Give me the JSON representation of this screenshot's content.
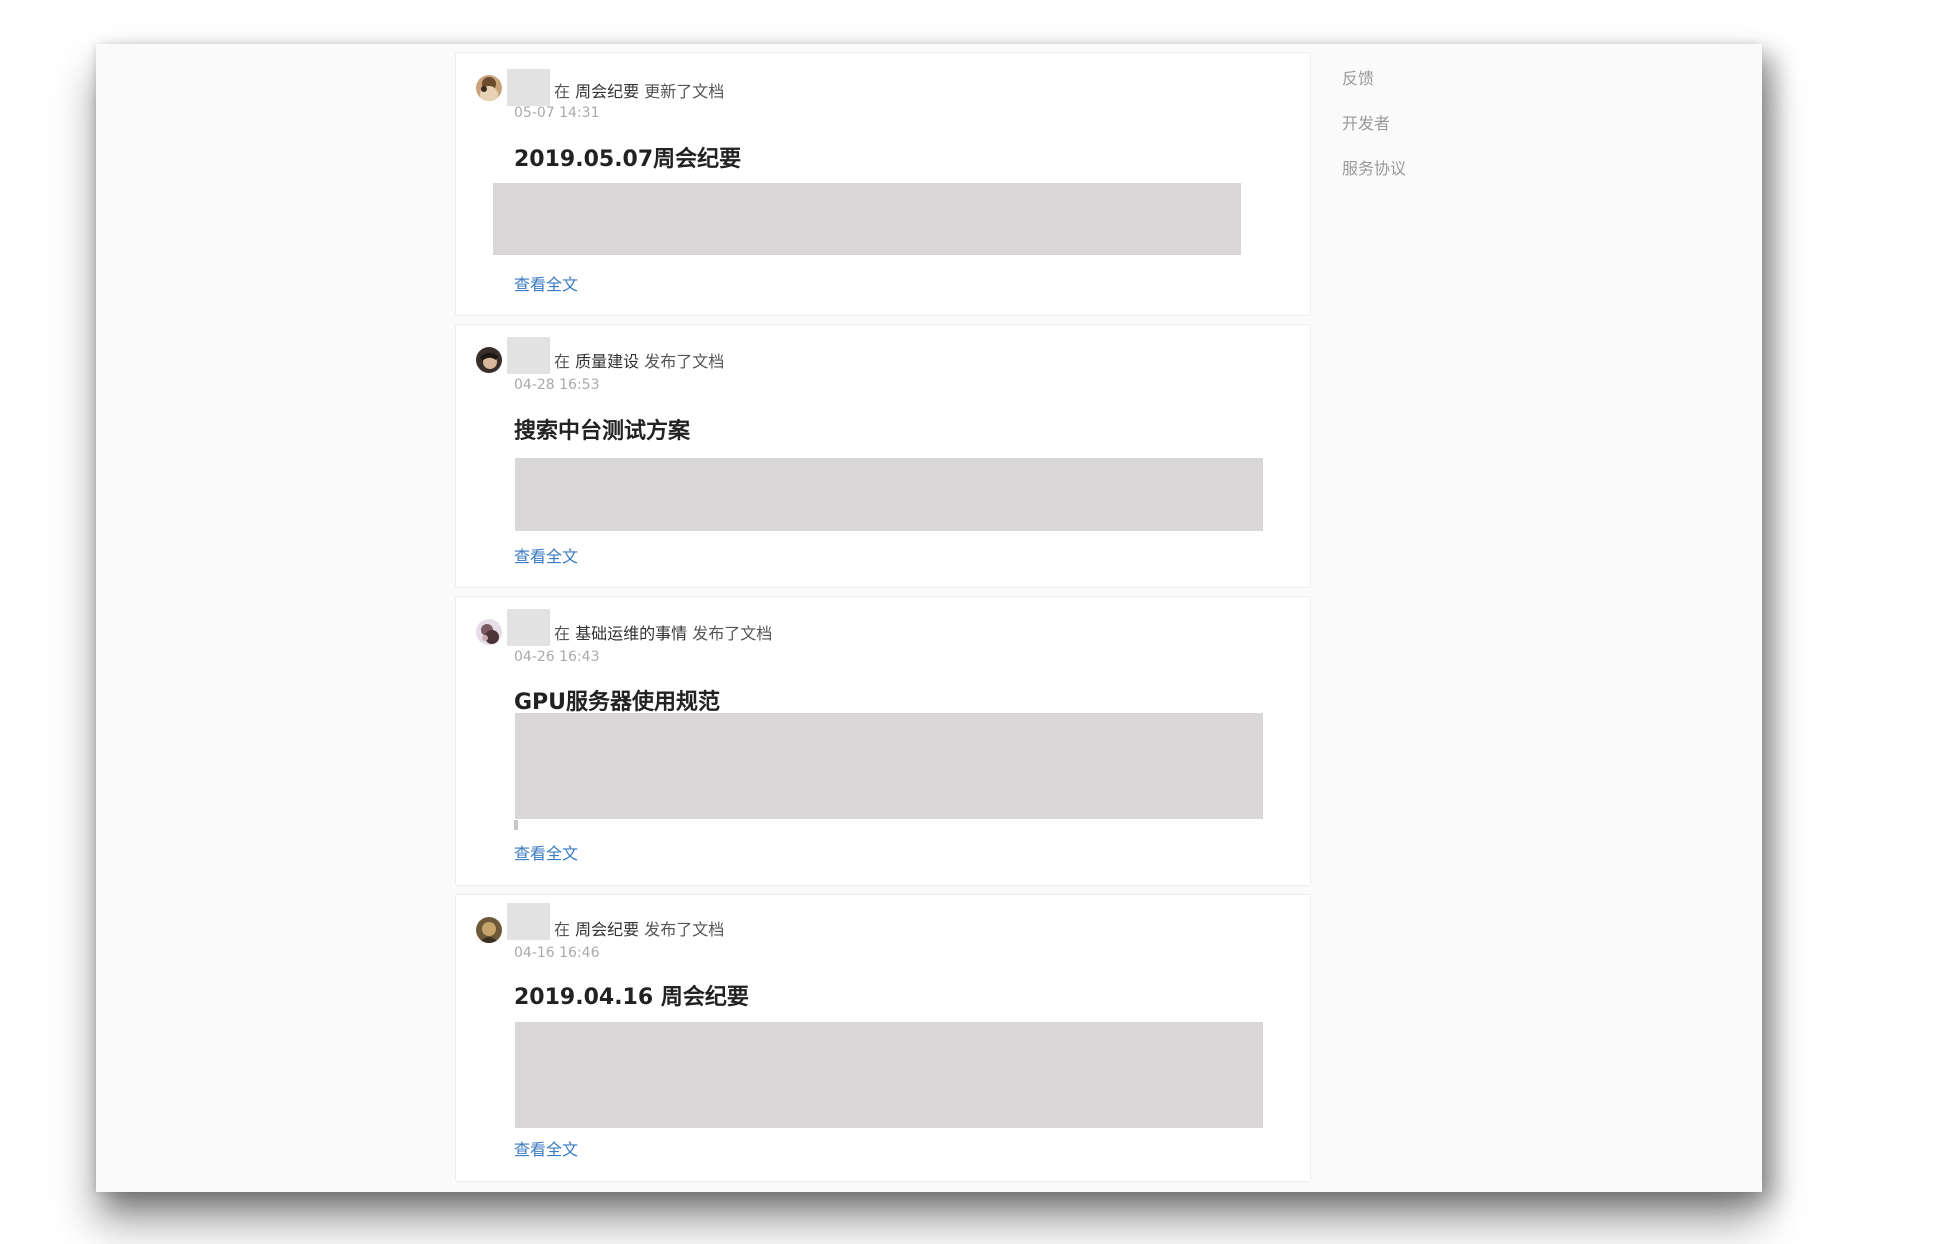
{
  "feed": {
    "preposition": "在",
    "read_more_label": "查看全文",
    "items": [
      {
        "space": "周会纪要",
        "action": "更新了文档",
        "time": "05-07 14:31",
        "title": "2019.05.07周会纪要"
      },
      {
        "space": "质量建设",
        "action": "发布了文档",
        "time": "04-28 16:53",
        "title": "搜索中台测试方案"
      },
      {
        "space": "基础运维的事情",
        "action": "发布了文档",
        "time": "04-26 16:43",
        "title": "GPU服务器使用规范"
      },
      {
        "space": "周会纪要",
        "action": "发布了文档",
        "time": "04-16 16:46",
        "title": "2019.04.16 周会纪要"
      }
    ]
  },
  "sidebar": {
    "links": [
      "反馈",
      "开发者",
      "服务协议"
    ]
  },
  "colors": {
    "link": "#3a7ac2",
    "redaction": "#d9d7d8",
    "page_background": "#fafafa"
  }
}
